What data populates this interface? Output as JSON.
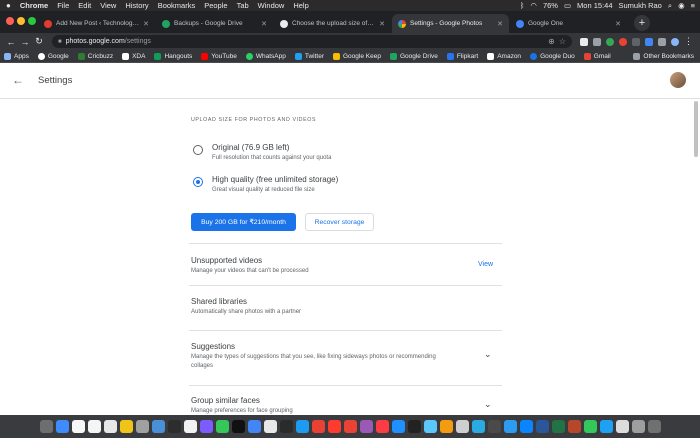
{
  "menubar": {
    "app": "Chrome",
    "items": [
      "File",
      "Edit",
      "View",
      "History",
      "Bookmarks",
      "People",
      "Tab",
      "Window",
      "Help"
    ],
    "battery": "76%",
    "clock": "Mon 15:44",
    "user": "Sumukh Rao"
  },
  "tabs": [
    {
      "title": "Add New Post ‹ Technology Pers",
      "color": "#e33b2e"
    },
    {
      "title": "Backups - Google Drive",
      "color": "#1fa463"
    },
    {
      "title": "Choose the upload size of your p",
      "color": "#e8eaed"
    },
    {
      "title": "Settings - Google Photos",
      "color": "#f4b400"
    },
    {
      "title": "Google One",
      "color": "#4285f4"
    }
  ],
  "address_bar": {
    "host": "photos.google.com",
    "path": "/settings"
  },
  "bookmarks": {
    "items": [
      {
        "label": "Apps",
        "color": "#8ab4f8"
      },
      {
        "label": "Google",
        "color": "#ffffff"
      },
      {
        "label": "Cricbuzz",
        "color": "#2e7d32"
      },
      {
        "label": "XDA",
        "color": "#ffffff"
      },
      {
        "label": "Hangouts",
        "color": "#0f9d58"
      },
      {
        "label": "YouTube",
        "color": "#ff0000"
      },
      {
        "label": "WhatsApp",
        "color": "#25d366"
      },
      {
        "label": "Twitter",
        "color": "#1da1f2"
      },
      {
        "label": "Google Keep",
        "color": "#fbbc04"
      },
      {
        "label": "Google Drive",
        "color": "#1fa463"
      },
      {
        "label": "Flipkart",
        "color": "#2874f0"
      },
      {
        "label": "Amazon",
        "color": "#ffffff"
      },
      {
        "label": "Google Duo",
        "color": "#1a73e8"
      },
      {
        "label": "Gmail",
        "color": "#ea4335"
      }
    ],
    "other": "Other Bookmarks"
  },
  "page": {
    "title": "Settings",
    "section_label": "UPLOAD SIZE FOR PHOTOS AND VIDEOS",
    "options": [
      {
        "title": "Original (76.9 GB left)",
        "subtitle": "Full resolution that counts against your quota",
        "selected": false
      },
      {
        "title": "High quality (free unlimited storage)",
        "subtitle": "Great visual quality at reduced file size",
        "selected": true
      }
    ],
    "buy_button": "Buy 200 GB for ₹210/month",
    "recover_button": "Recover storage",
    "rows": [
      {
        "title": "Unsupported videos",
        "subtitle": "Manage your videos that can't be processed",
        "action": "View"
      },
      {
        "title": "Shared libraries",
        "subtitle": "Automatically share photos with a partner"
      },
      {
        "title": "Suggestions",
        "subtitle": "Manage the types of suggestions that you see, like fixing sideways photos or recommending collages"
      },
      {
        "title": "Group similar faces",
        "subtitle": "Manage preferences for face grouping"
      }
    ]
  },
  "dock_colors": [
    "#6e6e6e",
    "#3d8bfd",
    "#f7f7f7",
    "#f5f5f5",
    "#e7e7e7",
    "#f0c419",
    "#a0a0a0",
    "#4a90d9",
    "#2d2d2d",
    "#f2f2f2",
    "#7c5cff",
    "#34c759",
    "#111111",
    "#4285f4",
    "#e8e8e8",
    "#2b2b2b",
    "#1c9bf0",
    "#e94235",
    "#ff3b30",
    "#ea4335",
    "#9b59b6",
    "#fc3c44",
    "#1e90ff",
    "#222222",
    "#5ac8fa",
    "#f39c12",
    "#cfcfcf",
    "#2aabe2",
    "#4a4a4a",
    "#2c9bf0",
    "#0a84ff",
    "#2b579a",
    "#217346",
    "#b7472a",
    "#34c759",
    "#1da1f2",
    "#dcdcdc",
    "#9e9e9e",
    "#707070"
  ]
}
